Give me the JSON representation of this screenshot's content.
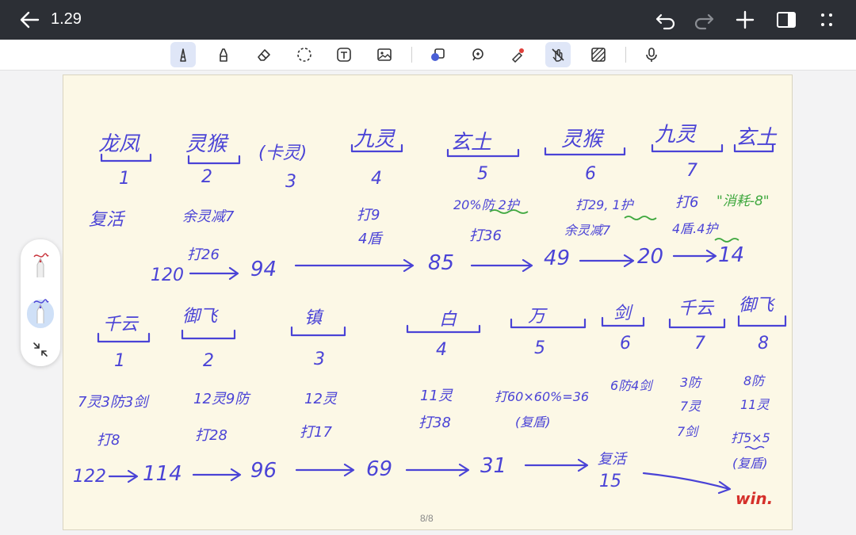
{
  "topbar": {
    "title": "1.29",
    "icons": [
      "back-arrow-icon",
      "undo-icon",
      "redo-icon",
      "plus-icon",
      "split-view-icon",
      "more-icon"
    ]
  },
  "toolbar": {
    "tools": [
      "pen-icon",
      "marker-icon",
      "eraser-icon",
      "lasso-icon",
      "text-icon",
      "image-icon",
      "shapes-icon",
      "zoom-icon",
      "laser-pointer-icon",
      "hand-draw-toggle-icon",
      "grid-pattern-icon",
      "microphone-icon"
    ]
  },
  "sidepanel": {
    "items": [
      "pen-red-icon",
      "pen-blue-icon",
      "collapse-icon"
    ]
  },
  "notes": {
    "row1_heroes": [
      "龙凤",
      "灵猴",
      "(卡灵)",
      "九灵",
      "玄土",
      "灵猴",
      "九灵",
      "玄土"
    ],
    "row1_nums": [
      "1",
      "2",
      "3",
      "4",
      "5",
      "6",
      "7"
    ],
    "row1_notes": {
      "a": "复活",
      "b": "余灵减7",
      "c": "打26",
      "d": "打9",
      "e": "4盾",
      "f": "20%防 2护",
      "g": "打36",
      "h": "打29, 1护",
      "i": "余灵减7",
      "j": "打6",
      "k": "\"消耗-8\"",
      "l": "4盾.4护"
    },
    "row1_chain": [
      "120",
      "94",
      "85",
      "49",
      "20",
      "14"
    ],
    "row2_heroes": [
      "千云",
      "御飞",
      "镇",
      "白",
      "万",
      "剑",
      "千云",
      "御飞"
    ],
    "row2_nums": [
      "1",
      "2",
      "3",
      "4",
      "5",
      "6",
      "7",
      "8"
    ],
    "row2_notes": {
      "a": "7灵3防3剑",
      "b": "打8",
      "c": "12灵9防",
      "d": "打28",
      "e": "12灵",
      "f": "打17",
      "g": "11灵",
      "h": "打38",
      "i": "打60×60%=36",
      "j": "(复盾)",
      "k": "6防4剑",
      "l": "3防",
      "m": "7灵",
      "n": "7剑",
      "o": "8防",
      "p": "11灵",
      "q": "打5×5",
      "r": "(复盾)"
    },
    "row2_chain": [
      "122",
      "114",
      "96",
      "69",
      "31",
      "复活",
      "15"
    ],
    "win": "win.",
    "page_indicator": "8/8"
  },
  "colors": {
    "ink_blue": "#4a43d6",
    "ink_green": "#3fa83f",
    "ink_red": "#d5302a",
    "paper": "#fcf8e6",
    "topbar": "#2c2f35",
    "active_tool": "#dfe6f7"
  }
}
